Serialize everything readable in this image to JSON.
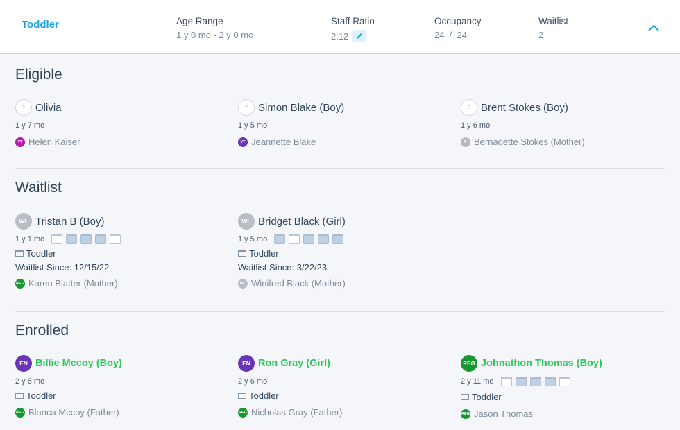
{
  "header": {
    "room": "Toddler",
    "age_range_label": "Age Range",
    "age_range_value": "1 y 0 mo - 2 y 0 mo",
    "staff_ratio_label": "Staff Ratio",
    "staff_ratio_value": "2:12",
    "occupancy_label": "Occupancy",
    "occupancy_value": "24  /  24",
    "waitlist_label": "Waitlist",
    "waitlist_value": "2"
  },
  "sections": {
    "eligible": "Eligible",
    "waitlist": "Waitlist",
    "enrolled": "Enrolled"
  },
  "eligible": [
    {
      "avatar": "?",
      "name": "Olivia",
      "age": "1 y 7 mo",
      "guardian_badge": "VT",
      "guardian": "Helen Kaiser"
    },
    {
      "avatar": "?",
      "name": "Simon Blake (Boy)",
      "age": "1 y 5 mo",
      "guardian_badge": "VT",
      "guardian": "Jeannette Blake"
    },
    {
      "avatar": "?",
      "name": "Brent Stokes (Boy)",
      "age": "1 y 6 mo",
      "guardian_badge": "P",
      "guardian": "Bernadette Stokes (Mother)"
    }
  ],
  "waitlist": [
    {
      "avatar": "WL",
      "name": "Tristan B (Boy)",
      "age": "1 y 1 mo",
      "days": [
        false,
        true,
        true,
        true,
        false
      ],
      "room": "Toddler",
      "since": "Waitlist Since: 12/15/22",
      "guardian_badge": "REG",
      "guardian": "Karen Blatter (Mother)"
    },
    {
      "avatar": "WL",
      "name": "Bridget Black (Girl)",
      "age": "1 y 5 mo",
      "days": [
        true,
        false,
        true,
        true,
        true
      ],
      "room": "Toddler",
      "since": "Waitlist Since: 3/22/23",
      "guardian_badge": "WL",
      "guardian": "Winifred Black (Mother)"
    }
  ],
  "enrolled": [
    {
      "avatar": "EN",
      "name": "Billie Mccoy (Boy)",
      "age": "2 y 6 mo",
      "room": "Toddler",
      "guardian_badge": "REG",
      "guardian": "Blanca Mccoy (Father)"
    },
    {
      "avatar": "EN",
      "name": "Ron Gray (Girl)",
      "age": "2 y 6 mo",
      "room": "Toddler",
      "guardian_badge": "REG",
      "guardian": "Nicholas Gray (Father)"
    },
    {
      "avatar": "REG",
      "name": "Johnathon Thomas (Boy)",
      "age": "2 y 11 mo",
      "days": [
        false,
        true,
        true,
        true,
        false
      ],
      "room": "Toddler",
      "guardian_badge": "REG",
      "guardian": "Jason Thomas"
    }
  ],
  "colors": {
    "accent": "#1ba6e0",
    "enrolled_name": "#2ec95a",
    "en_badge": "#6a35b5",
    "reg_badge": "#16982f"
  }
}
